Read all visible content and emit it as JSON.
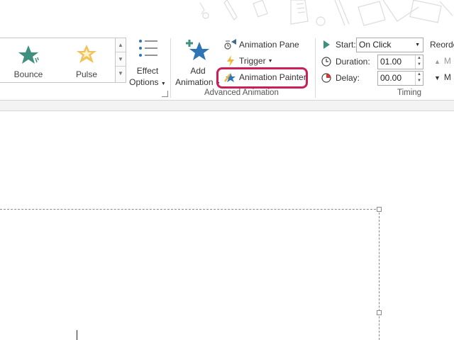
{
  "gallery": {
    "items": [
      {
        "label": "Bounce",
        "icon": "bounce-star-icon",
        "color": "#3f8f7e"
      },
      {
        "label": "Pulse",
        "icon": "pulse-star-icon",
        "color": "#e8a23a"
      }
    ]
  },
  "effect_options": {
    "line1": "Effect",
    "line2": "Options"
  },
  "add_animation": {
    "line1": "Add",
    "line2": "Animation"
  },
  "advanced_animation": {
    "animation_pane": "Animation Pane",
    "trigger": "Trigger",
    "animation_painter": "Animation Painter",
    "group_label": "Advanced Animation"
  },
  "timing": {
    "start_label": "Start:",
    "start_value": "On Click",
    "duration_label": "Duration:",
    "duration_value": "01.00",
    "delay_label": "Delay:",
    "delay_value": "00.00",
    "group_label": "Timing"
  },
  "reorder": {
    "title": "Reorde",
    "move_earlier": "M",
    "move_later": "M"
  },
  "colors": {
    "highlight": "#cc1f5a",
    "accent_blue": "#2e75b6",
    "play_green": "#3f8f7e"
  }
}
